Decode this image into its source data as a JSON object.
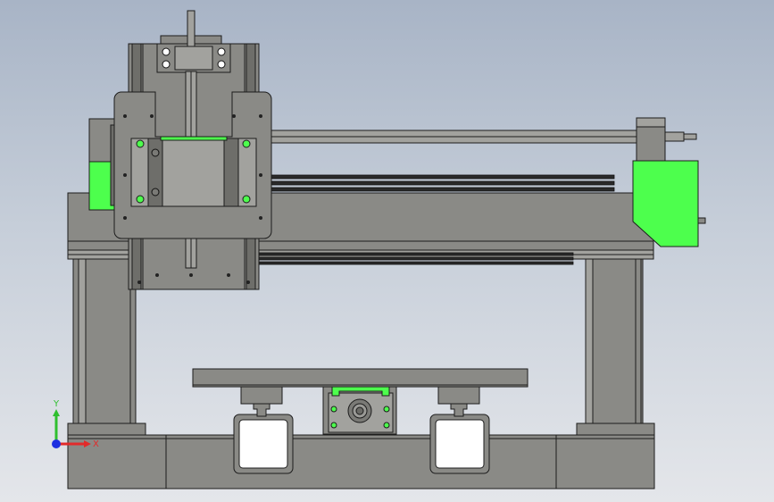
{
  "viewport": {
    "background_top": "#a8b4c6",
    "background_bottom": "#e4e6ea"
  },
  "model": {
    "body_color": "#8a8a86",
    "body_color_light": "#a4a4a0",
    "highlight_color": "#4dff4d",
    "edge_color": "#1c1c1c",
    "plate_color": "#8e8e8a"
  },
  "triad": {
    "x_label": "X",
    "y_label": "Y",
    "x_color": "#e22a2a",
    "y_color": "#2fbf2f",
    "z_color": "#1e2fe0"
  }
}
